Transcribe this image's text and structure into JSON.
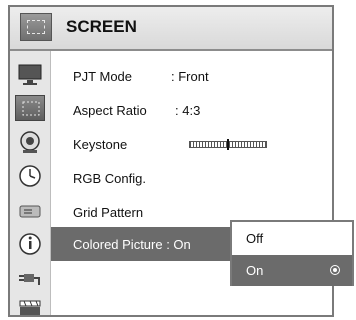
{
  "header": {
    "title": "SCREEN",
    "icon": "screen-grid-icon"
  },
  "rail_icons": [
    "monitor-icon",
    "screen-grid-icon",
    "camera-lens-icon",
    "clock-icon",
    "projector-icon",
    "info-icon",
    "plug-icon",
    "clapperboard-icon"
  ],
  "rows": [
    {
      "label": "PJT Mode",
      "value": ": Front"
    },
    {
      "label": "Aspect Ratio",
      "value": ": 4:3"
    },
    {
      "label": "Keystone",
      "value": "",
      "slider": 0.5
    },
    {
      "label": "RGB Config.",
      "value": ""
    },
    {
      "label": "Grid Pattern",
      "value": ""
    },
    {
      "label": "Colored Picture : On",
      "value": ""
    }
  ],
  "popup": {
    "options": [
      "Off",
      "On"
    ],
    "selected": "On"
  },
  "colors": {
    "selected_bg": "#6b6b6b",
    "header_bg": "#e0e0e0"
  }
}
